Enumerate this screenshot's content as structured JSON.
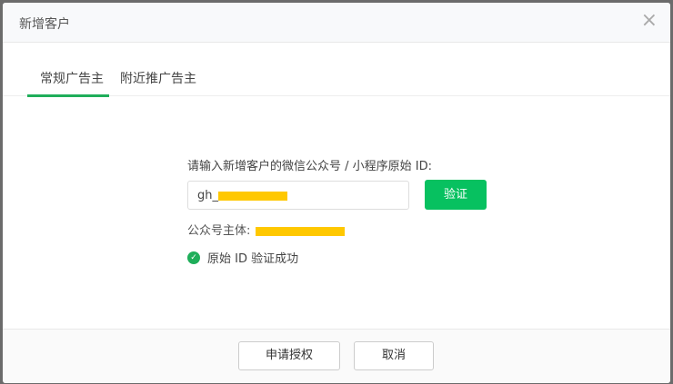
{
  "dialog": {
    "title": "新增客户",
    "close": "×"
  },
  "tabs": [
    {
      "label": "常规广告主"
    },
    {
      "label": "附近推广告主"
    }
  ],
  "form": {
    "label": "请输入新增客户的微信公众号 / 小程序原始 ID:",
    "input_value": "gh_",
    "verify_button": "验证",
    "subject_label": "公众号主体:",
    "success_icon": "✓",
    "success_text": "原始 ID 验证成功"
  },
  "footer": {
    "apply": "申请授权",
    "cancel": "取消"
  },
  "colors": {
    "accent": "#07c160",
    "mask": "#ffc800"
  }
}
